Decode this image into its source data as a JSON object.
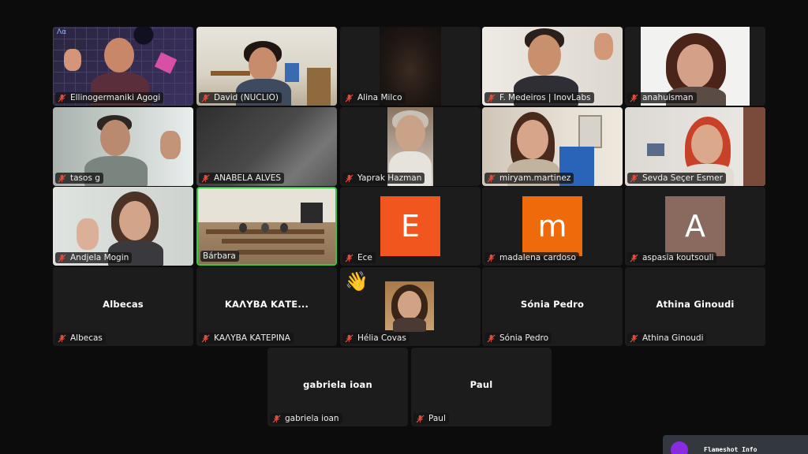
{
  "meeting": {
    "participants": [
      {
        "name": "Ellinogermaniki Agogi",
        "kind": "video",
        "muted": true
      },
      {
        "name": "David (NUCLIO)",
        "kind": "video",
        "muted": true
      },
      {
        "name": "Alina Milco",
        "kind": "video",
        "muted": true
      },
      {
        "name": "F. Medeiros | InovLabs",
        "kind": "video",
        "muted": true
      },
      {
        "name": "anahuisman",
        "kind": "video",
        "muted": true
      },
      {
        "name": "tasos g",
        "kind": "video",
        "muted": true
      },
      {
        "name": "ANABELA ALVES",
        "kind": "video",
        "muted": true
      },
      {
        "name": "Yaprak Hazman",
        "kind": "video",
        "muted": true
      },
      {
        "name": "miryam.martinez",
        "kind": "video",
        "muted": true
      },
      {
        "name": "Sevda Seçer Esmer",
        "kind": "video",
        "muted": true
      },
      {
        "name": "Andjela Mogin",
        "kind": "video",
        "muted": true
      },
      {
        "name": "Bárbara",
        "kind": "video",
        "muted": false,
        "active_speaker": true
      },
      {
        "name": "Ece",
        "kind": "avatar",
        "initial": "E",
        "color": "#f0561e",
        "muted": true
      },
      {
        "name": "madalena cardoso",
        "kind": "avatar",
        "initial": "m",
        "color": "#ee6a0a",
        "muted": true
      },
      {
        "name": "aspasia koutsouli",
        "kind": "avatar",
        "initial": "A",
        "color": "#8a6a5e",
        "muted": true
      },
      {
        "name": "Albecas",
        "kind": "name",
        "display": "Albecas",
        "muted": true
      },
      {
        "name": "ΚΑΛΥΒΑ ΚΑΤΕΡΙΝΑ",
        "kind": "name",
        "display": "ΚΑΛΥΒΑ ΚΑΤΕ...",
        "muted": true
      },
      {
        "name": "Hélia Covas",
        "kind": "photo",
        "reaction": "👋",
        "muted": true
      },
      {
        "name": "Sónia Pedro",
        "kind": "name",
        "display": "Sónia Pedro",
        "muted": true
      },
      {
        "name": "Athina Ginoudi",
        "kind": "name",
        "display": "Athina Ginoudi",
        "muted": true
      },
      {
        "name": "gabriela ioan",
        "kind": "name",
        "display": "gabriela ioan",
        "muted": true
      },
      {
        "name": "Paul",
        "kind": "name",
        "display": "Paul",
        "muted": true
      }
    ]
  },
  "flameshot": {
    "label": "Flameshot Info"
  },
  "colors": {
    "muted_icon": "#e24a3b",
    "active_border": "#2ecc40",
    "tile_bg": "#1c1c1c",
    "page_bg": "#0c0c0c"
  }
}
